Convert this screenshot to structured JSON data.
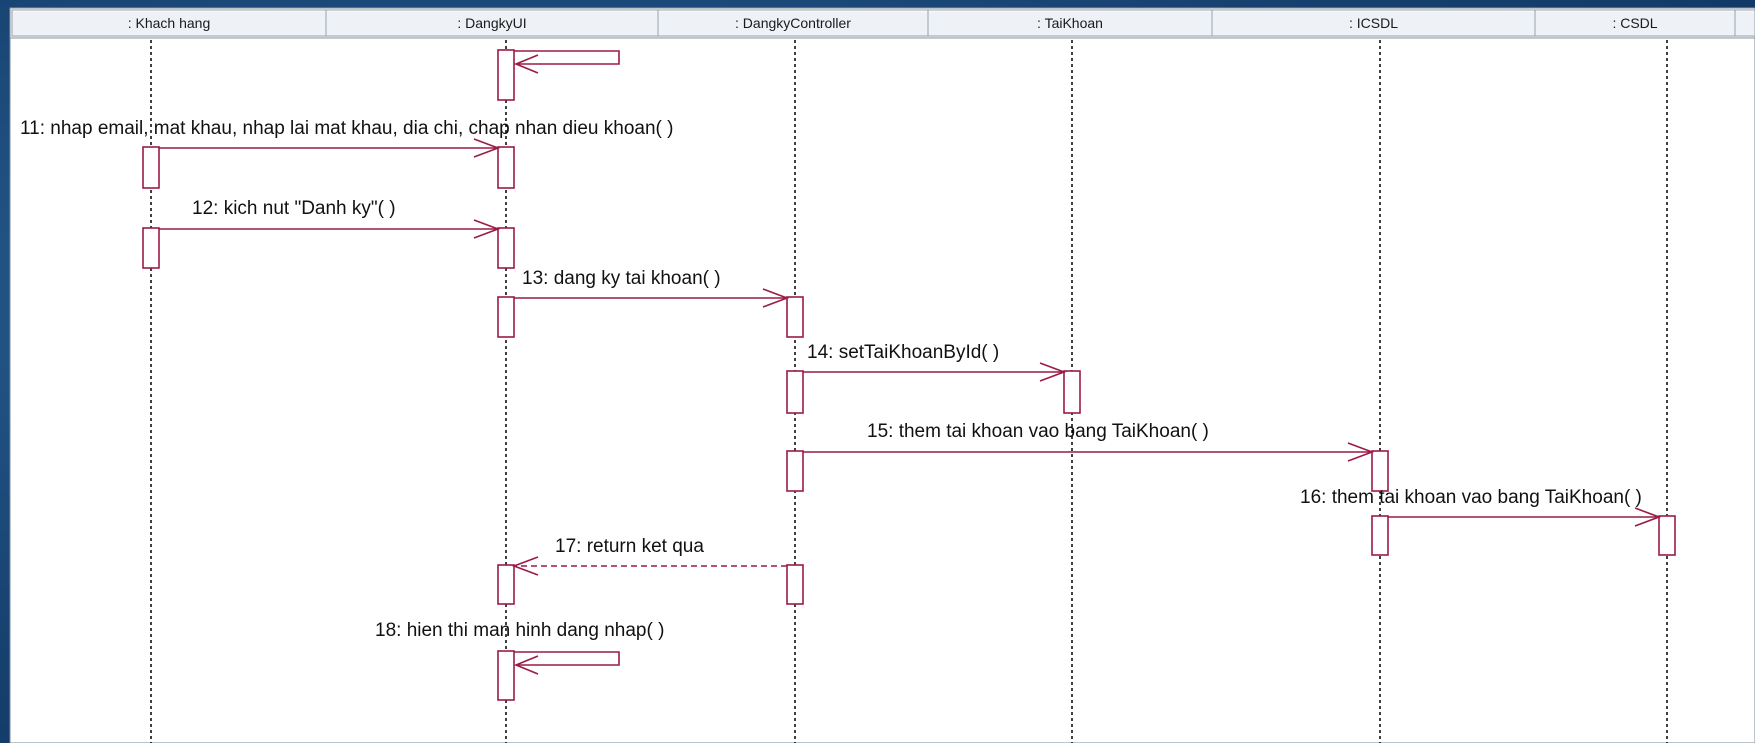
{
  "colors": {
    "background": "#1d4f7e",
    "panel": "#ffffff",
    "header_bg": "#eef1f5",
    "lifeline": "#000000",
    "message": "#9b1b45",
    "activation": "#9b1b45"
  },
  "lifelines": [
    {
      "id": "khachhang",
      "label": ": Khach hang"
    },
    {
      "id": "dangkyui",
      "label": ": DangkyUI"
    },
    {
      "id": "dangkycontroller",
      "label": ": DangkyController"
    },
    {
      "id": "taikhoan",
      "label": ": TaiKhoan"
    },
    {
      "id": "icsdl",
      "label": ": ICSDL"
    },
    {
      "id": "csdl",
      "label": ": CSDL"
    }
  ],
  "messages": [
    {
      "id": "m10",
      "from": "dangkyui",
      "to": "dangkyui",
      "label": "",
      "kind": "self"
    },
    {
      "id": "m11",
      "from": "khachhang",
      "to": "dangkyui",
      "label": "11: nhap email, mat khau, nhap lai mat khau, dia chi, chap nhan dieu khoan( )",
      "kind": "call"
    },
    {
      "id": "m12",
      "from": "khachhang",
      "to": "dangkyui",
      "label": "12: kich nut \"Danh ky\"( )",
      "kind": "call"
    },
    {
      "id": "m13",
      "from": "dangkyui",
      "to": "dangkycontroller",
      "label": "13: dang ky tai khoan( )",
      "kind": "call"
    },
    {
      "id": "m14",
      "from": "dangkycontroller",
      "to": "taikhoan",
      "label": "14: setTaiKhoanById( )",
      "kind": "call"
    },
    {
      "id": "m15",
      "from": "dangkycontroller",
      "to": "icsdl",
      "label": "15: them tai khoan vao bang TaiKhoan( )",
      "kind": "call"
    },
    {
      "id": "m16",
      "from": "icsdl",
      "to": "csdl",
      "label": "16: them tai khoan vao bang TaiKhoan( )",
      "kind": "call"
    },
    {
      "id": "m17",
      "from": "dangkycontroller",
      "to": "dangkyui",
      "label": "17: return ket qua",
      "kind": "return"
    },
    {
      "id": "m18",
      "from": "dangkyui",
      "to": "dangkyui",
      "label": "18: hien thi man hinh dang nhap( )",
      "kind": "self"
    }
  ]
}
